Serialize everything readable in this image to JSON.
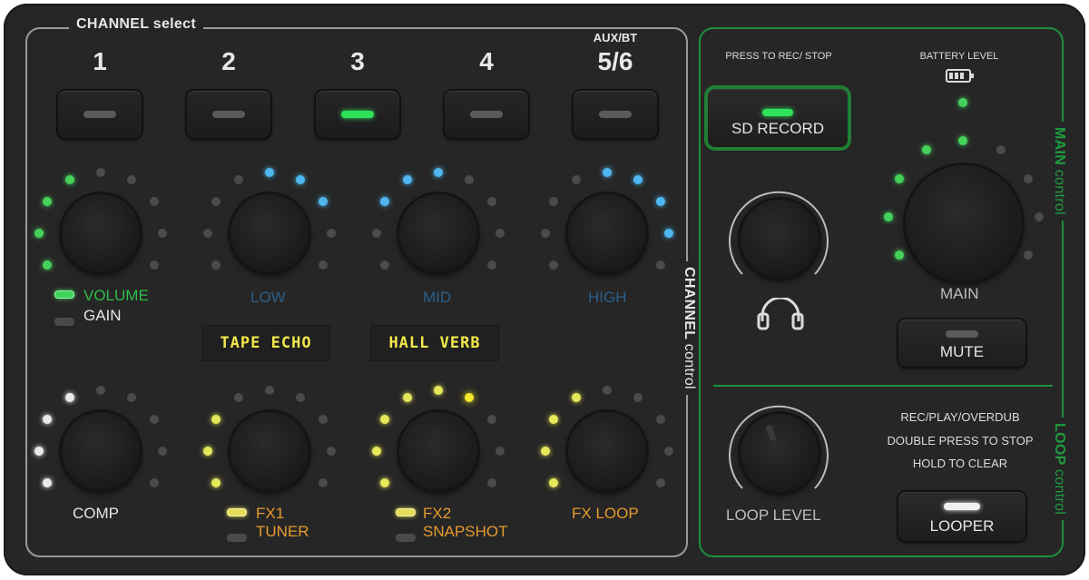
{
  "channel_section": {
    "title": "CHANNEL select",
    "side_label_bold": "CHANNEL",
    "side_label_light": "control",
    "channels": [
      {
        "number": "1",
        "sub": "",
        "active": false
      },
      {
        "number": "2",
        "sub": "",
        "active": false
      },
      {
        "number": "3",
        "sub": "",
        "active": true
      },
      {
        "number": "4",
        "sub": "",
        "active": false
      },
      {
        "number": "5/6",
        "sub": "AUX/BT",
        "active": false
      }
    ],
    "upper_knobs": {
      "volume_label": "VOLUME",
      "gain_label": "GAIN",
      "low_label": "LOW",
      "mid_label": "MID",
      "high_label": "HIGH"
    },
    "displays": {
      "fx1": "TAPE ECHO",
      "fx2": "HALL VERB"
    },
    "lower_knobs": {
      "comp_label": "COMP",
      "fx1_label": "FX1",
      "tuner_label": "TUNER",
      "fx2_label": "FX2",
      "snapshot_label": "SNAPSHOT",
      "fxloop_label": "FX LOOP"
    }
  },
  "main_section": {
    "side_label_bold": "MAIN",
    "side_label_light": "control",
    "press_to_rec": "PRESS TO REC/ STOP",
    "battery_label": "BATTERY LEVEL",
    "sd_record_label": "SD RECORD",
    "main_label": "MAIN",
    "mute_label": "MUTE"
  },
  "loop_section": {
    "side_label_bold": "LOOP",
    "side_label_light": "control",
    "loop_level_label": "LOOP LEVEL",
    "info_line1": "REC/PLAY/OVERDUB",
    "info_line2": "DOUBLE PRESS TO STOP",
    "info_line3": "HOLD TO CLEAR",
    "looper_label": "LOOPER"
  },
  "colors": {
    "panel": "#262626",
    "accent_green": "#1f8f3c",
    "led_green": "#2ee05a",
    "led_blue": "#4fb6ee",
    "led_yellow": "#e6e85a",
    "label_orange": "#e69a2e"
  }
}
